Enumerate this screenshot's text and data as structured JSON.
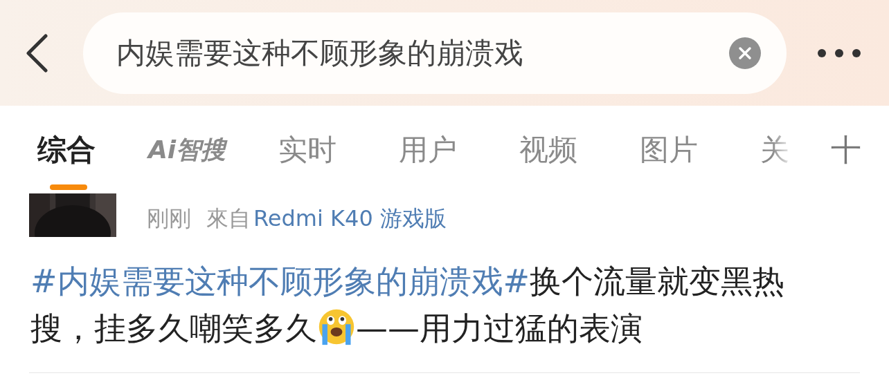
{
  "search": {
    "value": "内娱需要这种不顾形象的崩溃戏"
  },
  "tabs": [
    {
      "label": "综合",
      "selected": true,
      "kind": "text"
    },
    {
      "label": "Ai智搜",
      "selected": false,
      "kind": "ai"
    },
    {
      "label": "实时",
      "selected": false,
      "kind": "text"
    },
    {
      "label": "用户",
      "selected": false,
      "kind": "text"
    },
    {
      "label": "视频",
      "selected": false,
      "kind": "text"
    },
    {
      "label": "图片",
      "selected": false,
      "kind": "text"
    },
    {
      "label": "关",
      "selected": false,
      "kind": "text"
    }
  ],
  "add_tab": "十",
  "post": {
    "time": "刚刚",
    "source_prefix": "來自",
    "source": "Redmi K40 游戏版",
    "hashtag": "#内娱需要这种不顾形象的崩溃戏#",
    "text_before_emoji": "换个流量就变黑热搜，挂多久嘲笑多久",
    "text_after_emoji": "——用力过猛的表演"
  }
}
